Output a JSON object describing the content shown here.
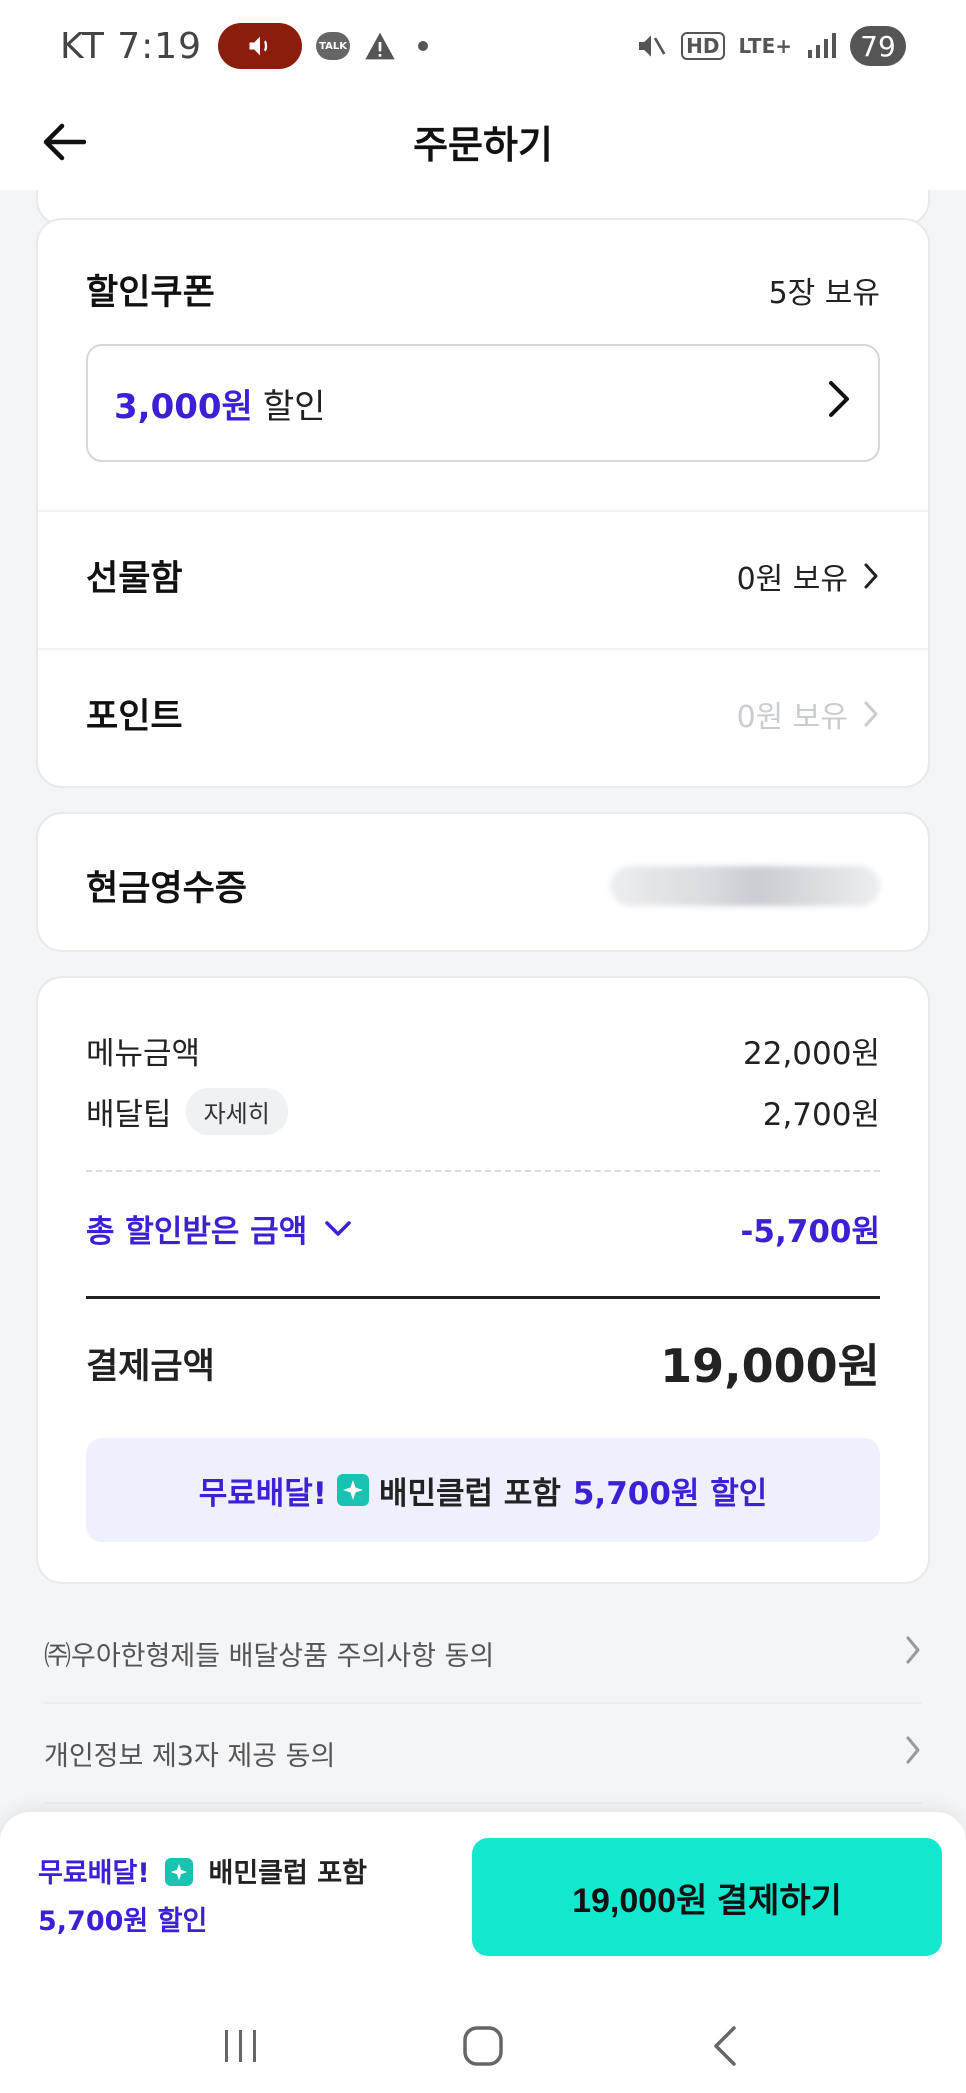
{
  "status_bar": {
    "carrier_time": "KT 7:19",
    "talk_label": "TALK",
    "hd_label": "HD",
    "lte_label": "LTE+",
    "battery": "79"
  },
  "header": {
    "title": "주문하기"
  },
  "coupon": {
    "title": "할인쿠폰",
    "count": "5장 보유",
    "amount": "3,000원",
    "word": "할인"
  },
  "gift_box": {
    "title": "선물함",
    "value": "0원 보유"
  },
  "points": {
    "title": "포인트",
    "value": "0원 보유"
  },
  "cash_receipt": {
    "title": "현금영수증"
  },
  "summary": {
    "menu_label": "메뉴금액",
    "menu_value": "22,000원",
    "delivery_label": "배달팁",
    "delivery_detail": "자세히",
    "delivery_value": "2,700원",
    "discount_label": "총 할인받은 금액",
    "discount_value": "-5,700원",
    "pay_label": "결제금액",
    "pay_value": "19,000원"
  },
  "promo": {
    "free_delivery": "무료배달!",
    "club": "배민클럽 포함",
    "discount": "5,700원 할인"
  },
  "agreements": [
    {
      "label": "㈜우아한형제들 배달상품 주의사항 동의"
    },
    {
      "label": "개인정보 제3자 제공 동의"
    }
  ],
  "bottom": {
    "free_delivery": "무료배달!",
    "club": "배민클럽 포함",
    "discount": "5,700원 할인",
    "pay_button": "19,000원 결제하기"
  },
  "colors": {
    "accent_purple": "#3d1fd6",
    "mint": "#12e8cf",
    "promo_bg": "#eef0fd"
  }
}
